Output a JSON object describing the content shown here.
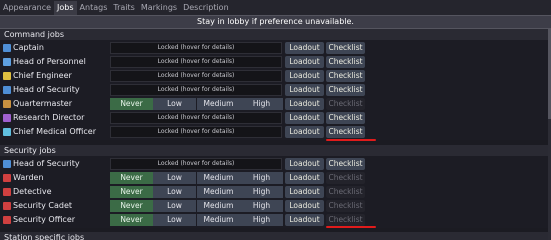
{
  "tabs": [
    {
      "label": "Appearance",
      "active": false
    },
    {
      "label": "Jobs",
      "active": true
    },
    {
      "label": "Antags",
      "active": false
    },
    {
      "label": "Traits",
      "active": false
    },
    {
      "label": "Markings",
      "active": false
    },
    {
      "label": "Description",
      "active": false
    }
  ],
  "banner": "Stay in lobby if preference unavailable.",
  "locked_text": "Locked (hover for details)",
  "pref_labels": {
    "never": "Never",
    "low": "Low",
    "medium": "Medium",
    "high": "High"
  },
  "loadout_label": "Loadout",
  "checklist_label": "Checklist",
  "sections": [
    {
      "title": "Command jobs",
      "jobs": [
        {
          "name": "Captain",
          "icon": "captain-icon",
          "icon_color": "#4f8fd6",
          "state": "locked",
          "loadout": true,
          "checklist_enabled": true
        },
        {
          "name": "Head of Personnel",
          "icon": "hop-icon",
          "icon_color": "#5fa0e0",
          "state": "locked",
          "loadout": true,
          "checklist_enabled": true
        },
        {
          "name": "Chief Engineer",
          "icon": "ce-icon",
          "icon_color": "#e0c040",
          "state": "locked",
          "loadout": true,
          "checklist_enabled": true
        },
        {
          "name": "Head of Security",
          "icon": "hos-icon",
          "icon_color": "#4f8fd6",
          "state": "locked",
          "loadout": true,
          "checklist_enabled": true
        },
        {
          "name": "Quartermaster",
          "icon": "qm-icon",
          "icon_color": "#c89040",
          "state": "prefs",
          "loadout": true,
          "checklist_enabled": false
        },
        {
          "name": "Research Director",
          "icon": "rd-icon",
          "icon_color": "#a060d0",
          "state": "locked",
          "loadout": true,
          "checklist_enabled": true
        },
        {
          "name": "Chief Medical Officer",
          "icon": "cmo-icon",
          "icon_color": "#60c0e0",
          "state": "locked",
          "loadout": true,
          "checklist_enabled": true
        }
      ]
    },
    {
      "title": "Security jobs",
      "jobs": [
        {
          "name": "Head of Security",
          "icon": "hos-icon",
          "icon_color": "#4f8fd6",
          "state": "locked",
          "loadout": true,
          "checklist_enabled": true
        },
        {
          "name": "Warden",
          "icon": "warden-icon",
          "icon_color": "#d04040",
          "state": "prefs",
          "loadout": true,
          "checklist_enabled": false
        },
        {
          "name": "Detective",
          "icon": "detective-icon",
          "icon_color": "#d04040",
          "state": "prefs",
          "loadout": true,
          "checklist_enabled": false
        },
        {
          "name": "Security Cadet",
          "icon": "cadet-icon",
          "icon_color": "#d04040",
          "state": "prefs",
          "loadout": true,
          "checklist_enabled": false
        },
        {
          "name": "Security Officer",
          "icon": "officer-icon",
          "icon_color": "#d04040",
          "state": "prefs",
          "loadout": true,
          "checklist_enabled": false
        }
      ]
    },
    {
      "title": "Station specific jobs",
      "jobs": []
    }
  ],
  "annotation_color": "#e01b1b"
}
